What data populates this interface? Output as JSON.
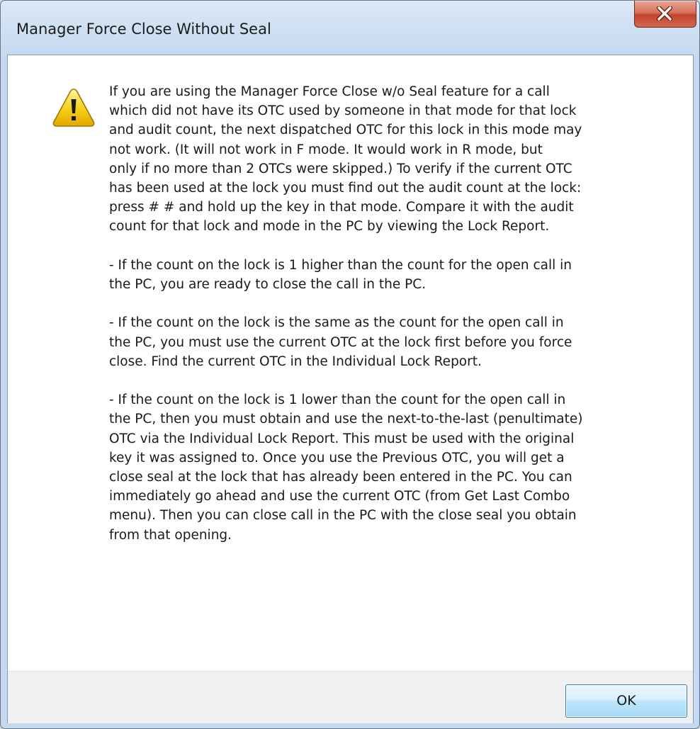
{
  "window": {
    "title": "Manager Force Close Without Seal"
  },
  "icons": {
    "close": "close-icon",
    "warning": "warning-icon"
  },
  "message": {
    "paragraphs": [
      "If you are using the Manager Force Close w/o Seal feature for a call\nwhich did not have its OTC used by someone in that mode for that lock\nand audit count, the next dispatched OTC for this lock in this mode may\nnot work.  (It will not work in F mode.  It would work in R mode, but\nonly if no more than 2 OTCs were skipped.)  To verify if the current OTC\nhas been used at the lock you must find out the audit count at the lock:\npress # # and hold up the key in that mode.  Compare it with the audit\ncount for that lock and mode in the PC by viewing the Lock Report.",
      "- If the count on the lock is 1 higher than the count for the open call in\nthe PC, you are ready to close the call in the PC.",
      "- If the count on the lock is the same as the count for the open call in\nthe PC, you must use the current OTC at the lock first before you force\nclose.  Find the current OTC in the Individual Lock Report.",
      "- If the count on the lock is 1 lower than the count for the open call in\nthe PC, then you must obtain and use the next-to-the-last (penultimate)\nOTC via the Individual Lock Report.  This must be used with the original\nkey it was assigned to.  Once you use the Previous OTC, you will get a\nclose seal at the lock that has already been entered in the PC.  You can\nimmediately go ahead and use the current OTC (from Get Last Combo\nmenu).  Then you can close call in the PC with the close seal you obtain\nfrom that opening."
    ]
  },
  "buttons": {
    "ok_label": "OK"
  },
  "colors": {
    "close_button": "#c5422a",
    "warning_fill": "#f5d000",
    "ok_border": "#3c7fb1"
  }
}
